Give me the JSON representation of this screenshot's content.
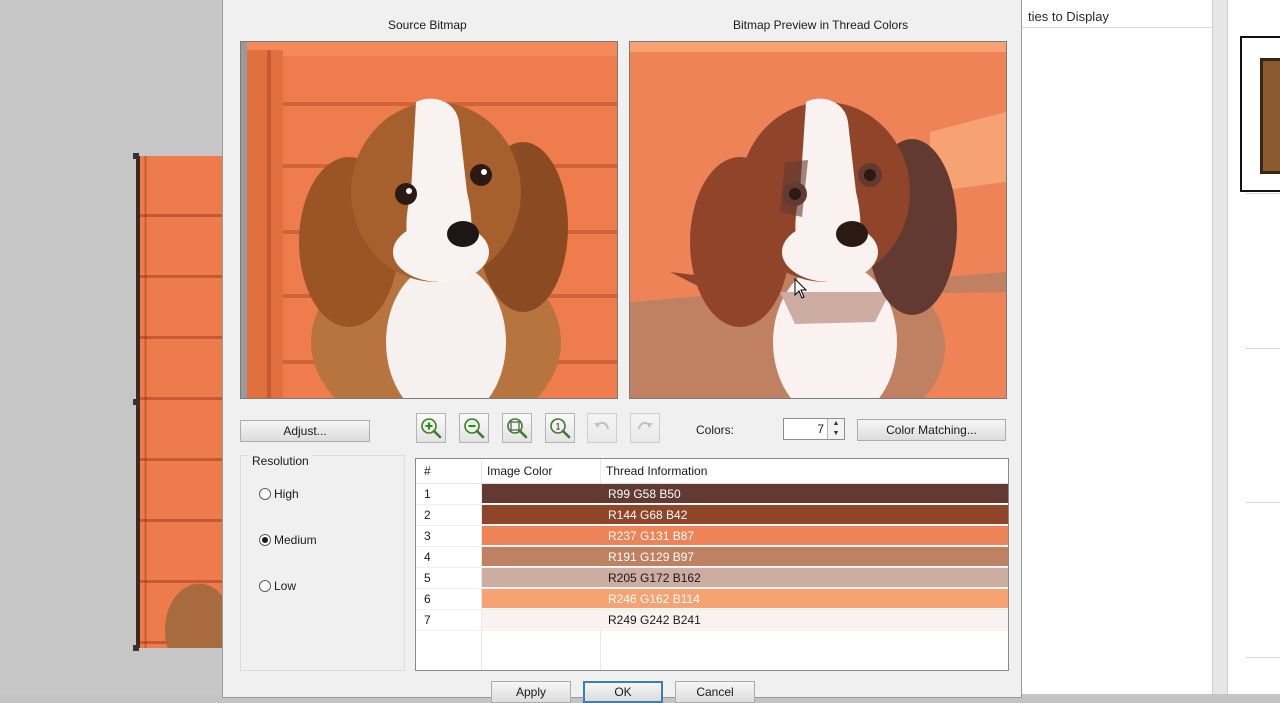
{
  "background": {
    "right_caption": "ties to Display"
  },
  "dialog": {
    "source_title": "Source Bitmap",
    "preview_title": "Bitmap Preview in Thread Colors",
    "adjust_label": "Adjust...",
    "colors_label": "Colors:",
    "colors_value": "7",
    "color_matching_label": "Color Matching...",
    "resolution": {
      "title": "Resolution",
      "options": [
        "High",
        "Medium",
        "Low"
      ],
      "selected": "Medium"
    },
    "toolbar": [
      "zoom-in-icon",
      "zoom-out-icon",
      "zoom-fit-icon",
      "zoom-actual-icon",
      "undo-icon",
      "redo-icon"
    ],
    "table": {
      "headers": [
        "#",
        "Image Color",
        "Thread Information"
      ],
      "rows": [
        {
          "num": "1",
          "color": "#633A32",
          "info": "R99 G58 B50"
        },
        {
          "num": "2",
          "color": "#90442A",
          "info": "R144 G68 B42"
        },
        {
          "num": "3",
          "color": "#ED8357",
          "info": "R237 G131 B87"
        },
        {
          "num": "4",
          "color": "#BF8161",
          "info": "R191 G129 B97"
        },
        {
          "num": "5",
          "color": "#CDACA2",
          "info": "R205 G172 B162"
        },
        {
          "num": "6",
          "color": "#F6A272",
          "info": "R246 G162 B114"
        },
        {
          "num": "7",
          "color": "#F9F2F1",
          "info": "R249 G242 B241"
        }
      ]
    },
    "buttons": {
      "apply": "Apply",
      "ok": "OK",
      "cancel": "Cancel"
    }
  }
}
